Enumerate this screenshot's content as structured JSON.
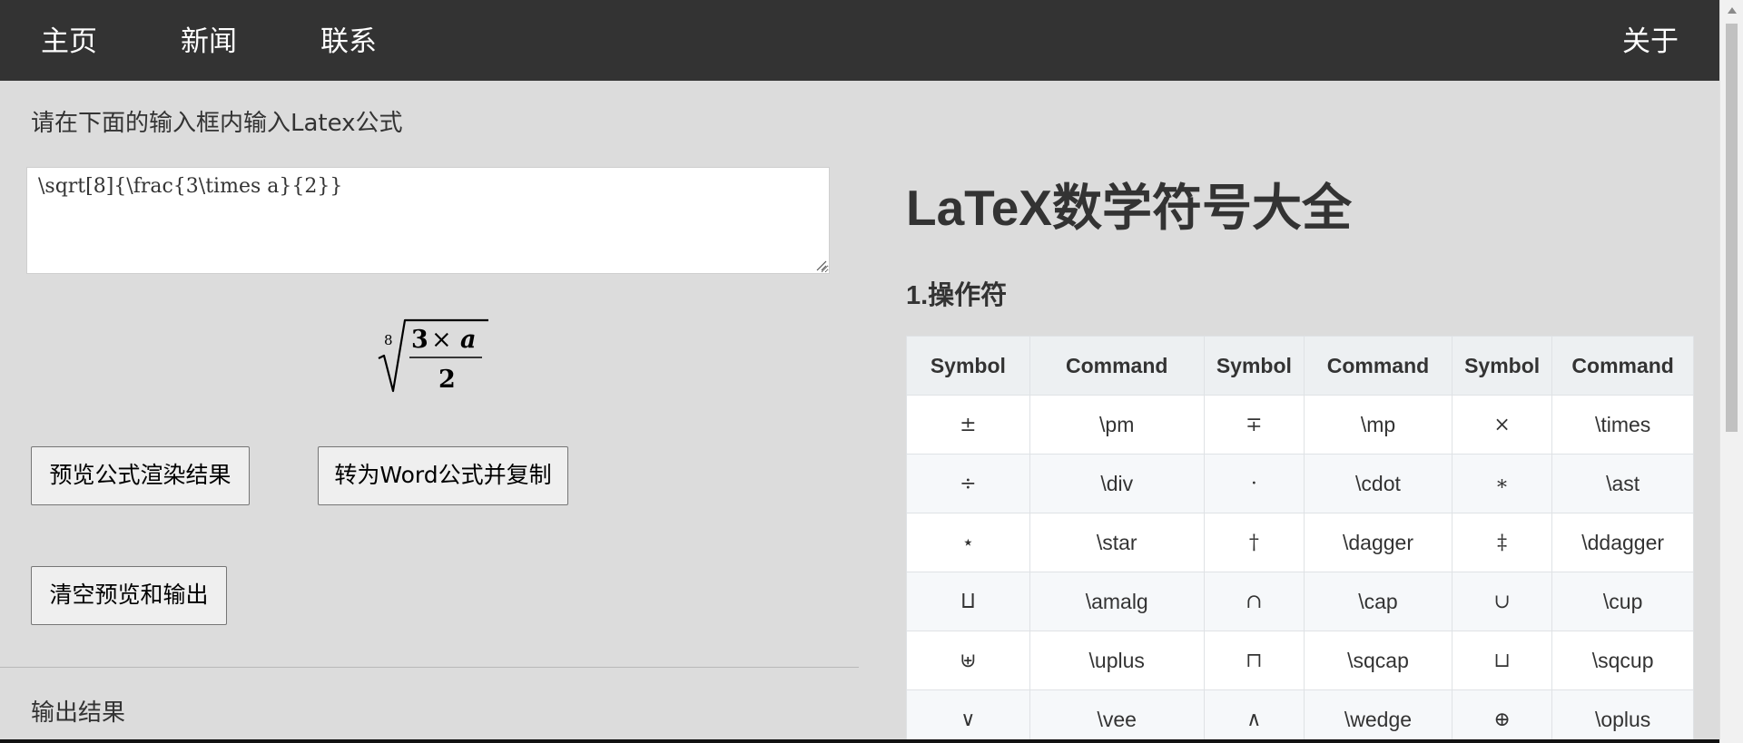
{
  "nav": {
    "home": "主页",
    "news": "新闻",
    "contact": "联系",
    "about": "关于"
  },
  "editor": {
    "instruction": "请在下面的输入框内输入Latex公式",
    "input_value": "\\sqrt[8]{\\frac{3\\times a}{2}}",
    "preview": {
      "index": "8",
      "numerator_num": "3",
      "times": "×",
      "numerator_var": "a",
      "denominator": "2"
    },
    "buttons": {
      "preview": "预览公式渲染结果",
      "word": "转为Word公式并复制",
      "clear": "清空预览和输出"
    },
    "output_label": "输出结果"
  },
  "reference": {
    "title": "LaTeX数学符号大全",
    "section": "1.操作符",
    "headers": [
      "Symbol",
      "Command",
      "Symbol",
      "Command",
      "Symbol",
      "Command"
    ],
    "rows": [
      [
        "±",
        "\\pm",
        "∓",
        "\\mp",
        "×",
        "\\times"
      ],
      [
        "÷",
        "\\div",
        "·",
        "\\cdot",
        "∗",
        "\\ast"
      ],
      [
        "⋆",
        "\\star",
        "†",
        "\\dagger",
        "‡",
        "\\ddagger"
      ],
      [
        "⨿",
        "\\amalg",
        "∩",
        "\\cap",
        "∪",
        "\\cup"
      ],
      [
        "⊎",
        "\\uplus",
        "⊓",
        "\\sqcap",
        "⊔",
        "\\sqcup"
      ],
      [
        "∨",
        "\\vee",
        "∧",
        "\\wedge",
        "⊕",
        "\\oplus"
      ]
    ]
  },
  "colors": {
    "nav_bg": "#333333",
    "page_bg": "#dcdcdc",
    "table_header_bg": "#edf0f2",
    "table_even_bg": "#f6f8fa"
  }
}
